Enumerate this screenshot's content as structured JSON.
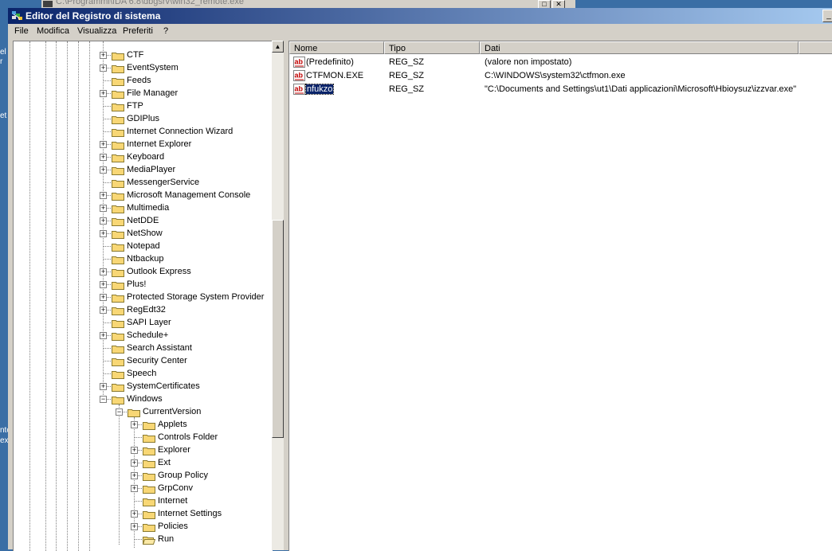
{
  "background_window": {
    "title": "C:\\Programmi\\IDA 6.8\\dbgsrv\\win32_remote.exe"
  },
  "desktop_fragments": [
    "el",
    "r",
    "et",
    "nto",
    "ex"
  ],
  "window": {
    "title": "Editor del Registro di sistema",
    "controls": {
      "minimize": "_",
      "maximize": "□",
      "close": "✕"
    }
  },
  "menu": [
    "File",
    "Modifica",
    "Visualizza",
    "Preferiti",
    "?"
  ],
  "tree": {
    "items": [
      {
        "label": "CTF",
        "expand": "+",
        "depth": 0
      },
      {
        "label": "EventSystem",
        "expand": "+",
        "depth": 0
      },
      {
        "label": "Feeds",
        "expand": "",
        "depth": 0
      },
      {
        "label": "File Manager",
        "expand": "+",
        "depth": 0
      },
      {
        "label": "FTP",
        "expand": "",
        "depth": 0
      },
      {
        "label": "GDIPlus",
        "expand": "",
        "depth": 0
      },
      {
        "label": "Internet Connection Wizard",
        "expand": "",
        "depth": 0
      },
      {
        "label": "Internet Explorer",
        "expand": "+",
        "depth": 0
      },
      {
        "label": "Keyboard",
        "expand": "+",
        "depth": 0
      },
      {
        "label": "MediaPlayer",
        "expand": "+",
        "depth": 0
      },
      {
        "label": "MessengerService",
        "expand": "",
        "depth": 0
      },
      {
        "label": "Microsoft Management Console",
        "expand": "+",
        "depth": 0
      },
      {
        "label": "Multimedia",
        "expand": "+",
        "depth": 0
      },
      {
        "label": "NetDDE",
        "expand": "+",
        "depth": 0
      },
      {
        "label": "NetShow",
        "expand": "+",
        "depth": 0
      },
      {
        "label": "Notepad",
        "expand": "",
        "depth": 0
      },
      {
        "label": "Ntbackup",
        "expand": "",
        "depth": 0
      },
      {
        "label": "Outlook Express",
        "expand": "+",
        "depth": 0
      },
      {
        "label": "Plus!",
        "expand": "+",
        "depth": 0
      },
      {
        "label": "Protected Storage System Provider",
        "expand": "+",
        "depth": 0
      },
      {
        "label": "RegEdt32",
        "expand": "+",
        "depth": 0
      },
      {
        "label": "SAPI Layer",
        "expand": "",
        "depth": 0
      },
      {
        "label": "Schedule+",
        "expand": "+",
        "depth": 0
      },
      {
        "label": "Search Assistant",
        "expand": "",
        "depth": 0
      },
      {
        "label": "Security Center",
        "expand": "",
        "depth": 0
      },
      {
        "label": "Speech",
        "expand": "",
        "depth": 0
      },
      {
        "label": "SystemCertificates",
        "expand": "+",
        "depth": 0
      },
      {
        "label": "Windows",
        "expand": "-",
        "depth": 0
      },
      {
        "label": "CurrentVersion",
        "expand": "-",
        "depth": 1
      },
      {
        "label": "Applets",
        "expand": "+",
        "depth": 2
      },
      {
        "label": "Controls Folder",
        "expand": "",
        "depth": 2
      },
      {
        "label": "Explorer",
        "expand": "+",
        "depth": 2
      },
      {
        "label": "Ext",
        "expand": "+",
        "depth": 2
      },
      {
        "label": "Group Policy",
        "expand": "+",
        "depth": 2
      },
      {
        "label": "GrpConv",
        "expand": "+",
        "depth": 2
      },
      {
        "label": "Internet",
        "expand": "",
        "depth": 2
      },
      {
        "label": "Internet Settings",
        "expand": "+",
        "depth": 2
      },
      {
        "label": "Policies",
        "expand": "+",
        "depth": 2
      },
      {
        "label": "Run",
        "expand": "",
        "depth": 2,
        "open": true
      }
    ]
  },
  "list": {
    "columns": [
      "Nome",
      "Tipo",
      "Dati"
    ],
    "rows": [
      {
        "name": "(Predefinito)",
        "type": "REG_SZ",
        "data": "(valore non impostato)"
      },
      {
        "name": "CTFMON.EXE",
        "type": "REG_SZ",
        "data": "C:\\WINDOWS\\system32\\ctfmon.exe"
      },
      {
        "name": "nfukzo",
        "type": "REG_SZ",
        "data": "\"C:\\Documents and Settings\\ut1\\Dati applicazioni\\Microsoft\\Hbioysuz\\izzvar.exe\"",
        "selected": true
      }
    ]
  },
  "colors": {
    "title_start": "#0a246a",
    "title_end": "#a6caf0",
    "desktop": "#3a6ea5",
    "folder": "#f8d775",
    "selection": "#0a246a"
  },
  "icons": {
    "app": "regedit-icon",
    "folder": "folder-icon",
    "string_value": "reg-sz-icon"
  }
}
